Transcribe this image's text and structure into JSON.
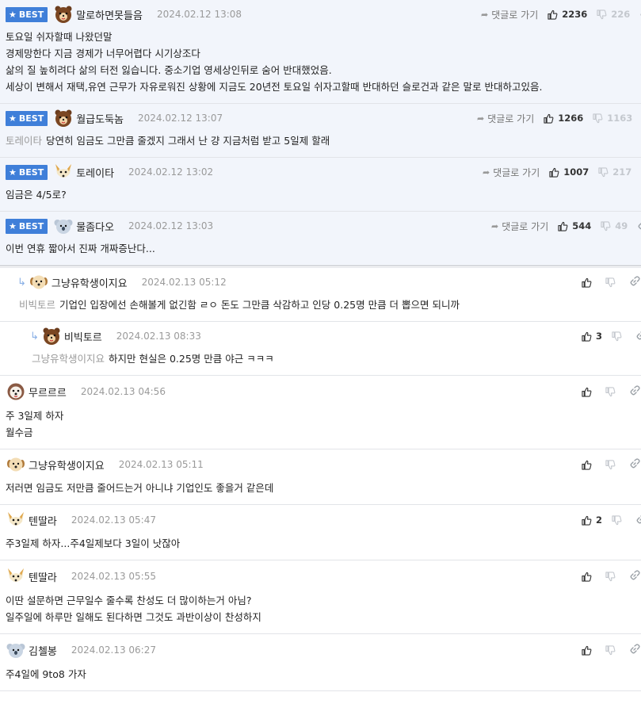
{
  "ui": {
    "best_label": "BEST",
    "reply_label": "댓글로 가기",
    "star_glyph": "★",
    "arrow_glyph": "➦",
    "reply_glyph": "↳"
  },
  "comments": [
    {
      "best": true,
      "avatar": "bear-avatar-icon",
      "nick": "말로하면못들음",
      "date": "2024.02.12 13:08",
      "up": "2236",
      "down": "226",
      "mention": "",
      "lines": [
        "토요일 쉬자할때 나왔던말",
        "경제망한다 지금 경제가 너무어렵다 시기상조다",
        "삶의 질 높히려다 삶의 터전 잃습니다. 중소기업 영세상인뒤로 숨어 반대했었음.",
        "세상이 변해서 재택,유연 근무가 자유로워진 상황에 지금도 20년전 토요일 쉬자고할때 반대하던 슬로건과 같은 말로 반대하고있음."
      ]
    },
    {
      "best": true,
      "avatar": "bear-avatar-icon",
      "nick": "월급도둑놈",
      "date": "2024.02.12 13:07",
      "up": "1266",
      "down": "1163",
      "mention": "토레이타",
      "lines": [
        "당연히 임금도 그만큼 줄겠지 그래서 난 걍 지금처럼 받고 5일제 할래"
      ]
    },
    {
      "best": true,
      "avatar": "fox-avatar-icon",
      "nick": "토레이타",
      "date": "2024.02.12 13:02",
      "up": "1007",
      "down": "217",
      "mention": "",
      "lines": [
        "임금은 4/5로?"
      ]
    },
    {
      "best": true,
      "avatar": "koala-avatar-icon",
      "nick": "물좀다오",
      "date": "2024.02.12 13:03",
      "up": "544",
      "down": "49",
      "mention": "",
      "lines": [
        "이번 연휴 짧아서 진짜 개짜증난다..."
      ]
    },
    {
      "best": false,
      "level": 1,
      "avatar": "dog-avatar-icon",
      "nick": "그냥유학생이지요",
      "date": "2024.02.13 05:12",
      "up": "",
      "down": "",
      "mention": "비빅토르",
      "lines": [
        "기업인 입장에선 손해볼게 없긴함 ㄹㅇ 돈도 그만큼 삭감하고 인당 0.25명 만큼 더 뽑으면 되니까"
      ]
    },
    {
      "best": false,
      "level": 2,
      "avatar": "bear-avatar-icon",
      "nick": "비빅토르",
      "date": "2024.02.13 08:33",
      "up": "3",
      "down": "",
      "mention": "그냥유학생이지요",
      "lines": [
        "하지만 현실은 0.25명 만큼 야근 ㅋㅋㅋ"
      ]
    },
    {
      "best": false,
      "level": 0,
      "avatar": "puppy-avatar-icon",
      "nick": "무르르르",
      "date": "2024.02.13 04:56",
      "up": "",
      "down": "",
      "mention": "",
      "lines": [
        "주 3일제 하자",
        "월수금"
      ]
    },
    {
      "best": false,
      "level": 0,
      "avatar": "dog-avatar-icon",
      "nick": "그냥유학생이지요",
      "date": "2024.02.13 05:11",
      "up": "",
      "down": "",
      "mention": "",
      "lines": [
        "저러면 임금도 저만큼 줄어드는거 아니냐 기업인도 좋을거 같은데"
      ]
    },
    {
      "best": false,
      "level": 0,
      "avatar": "fox-avatar-icon",
      "nick": "텐딸라",
      "date": "2024.02.13 05:47",
      "up": "2",
      "down": "",
      "mention": "",
      "lines": [
        "주3일제 하자...주4일제보다 3일이 낫잖아"
      ]
    },
    {
      "best": false,
      "level": 0,
      "avatar": "fox-avatar-icon",
      "nick": "텐딸라",
      "date": "2024.02.13 05:55",
      "up": "",
      "down": "",
      "mention": "",
      "lines": [
        "이딴 설문하면 근무일수 줄수록 찬성도 더 많이하는거 아님?",
        "일주일에 하루만 일해도 된다하면 그것도 과반이상이 찬성하지"
      ]
    },
    {
      "best": false,
      "level": 0,
      "avatar": "koala-avatar-icon",
      "nick": "김첼봉",
      "date": "2024.02.13 06:27",
      "up": "",
      "down": "",
      "mention": "",
      "lines": [
        "주4일에 9to8 가자"
      ]
    }
  ],
  "colors": {
    "best_badge": "#3f7fd9",
    "best_bg": "#f2f5fb",
    "muted": "#9a9a9a"
  }
}
